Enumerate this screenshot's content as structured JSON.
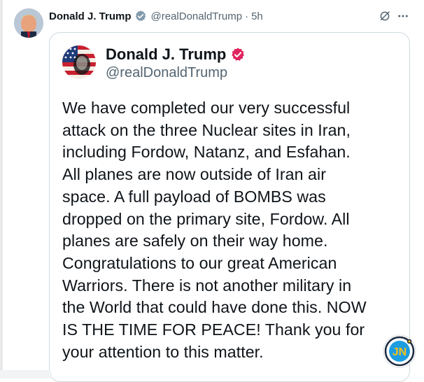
{
  "post": {
    "author_name": "Donald J. Trump",
    "handle": "@realDonaldTrump",
    "separator": "·",
    "time": "5h",
    "icons": {
      "verified": "verified-badge-icon",
      "grok": "grok-icon",
      "more": "more-icon"
    }
  },
  "quoted": {
    "author_name": "Donald J. Trump",
    "handle": "@realDonaldTrump",
    "lines": [
      "We have completed our very successful",
      "attack on the three Nuclear sites in Iran,",
      "including Fordow, Natanz, and Esfahan.",
      "All planes are now outside of Iran air",
      "space. A full payload of BOMBS was",
      "dropped on the primary site, Fordow. All",
      "planes are safely on their way home.",
      "Congratulations to our great American",
      "Warriors. There is not another military in",
      "the World that could have done this. NOW",
      "IS THE TIME FOR PEACE! Thank you for",
      "your attention to this matter."
    ]
  },
  "watermark": {
    "text": "JN"
  },
  "colors": {
    "text": "#0f1419",
    "muted": "#536471",
    "border": "#cfd9de",
    "verified_badge": "#829aab",
    "card_verified_badge": "#e0245e"
  }
}
